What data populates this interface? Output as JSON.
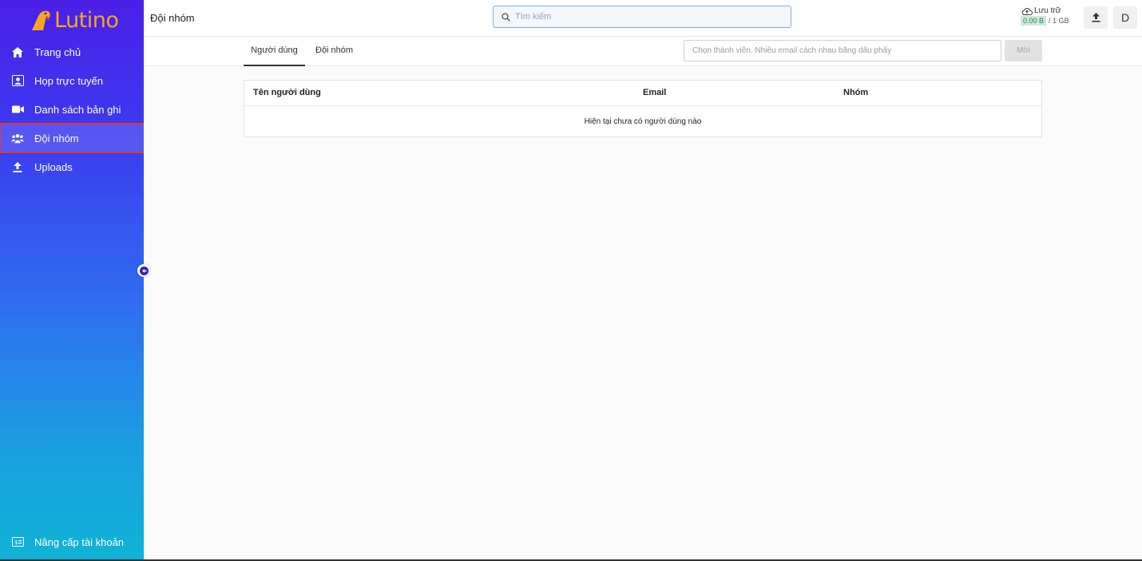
{
  "app": {
    "name": "Lutino",
    "brand_color": "#f5a623"
  },
  "sidebar": {
    "items": [
      {
        "label": "Trang chủ",
        "icon": "home-icon",
        "active": false
      },
      {
        "label": "Họp trực tuyến",
        "icon": "meeting-icon",
        "active": false
      },
      {
        "label": "Danh sách bản ghi",
        "icon": "video-camera-icon",
        "active": false
      },
      {
        "label": "Đội nhóm",
        "icon": "team-icon",
        "active": true
      },
      {
        "label": "Uploads",
        "icon": "upload-icon",
        "active": false
      }
    ],
    "bottom_item": {
      "label": "Nâng cấp tài khoản",
      "icon": "upgrade-card-icon"
    }
  },
  "header": {
    "title": "Đội nhóm",
    "search_placeholder": "Tìm kiếm",
    "storage": {
      "label": "Lưu trữ",
      "used": "0.00 B",
      "total": "/ 1 GB"
    },
    "avatar_letter": "D"
  },
  "tabs": [
    {
      "label": "Người dùng",
      "active": true
    },
    {
      "label": "Đội nhóm",
      "active": false
    }
  ],
  "invite": {
    "placeholder": "Chọn thành viên. Nhiều email cách nhau bằng dấu phẩy",
    "button_label": "Mời"
  },
  "table": {
    "columns": [
      "Tên người dùng",
      "Email",
      "Nhóm"
    ],
    "empty_message": "Hiện tại chưa có người dùng nào"
  }
}
